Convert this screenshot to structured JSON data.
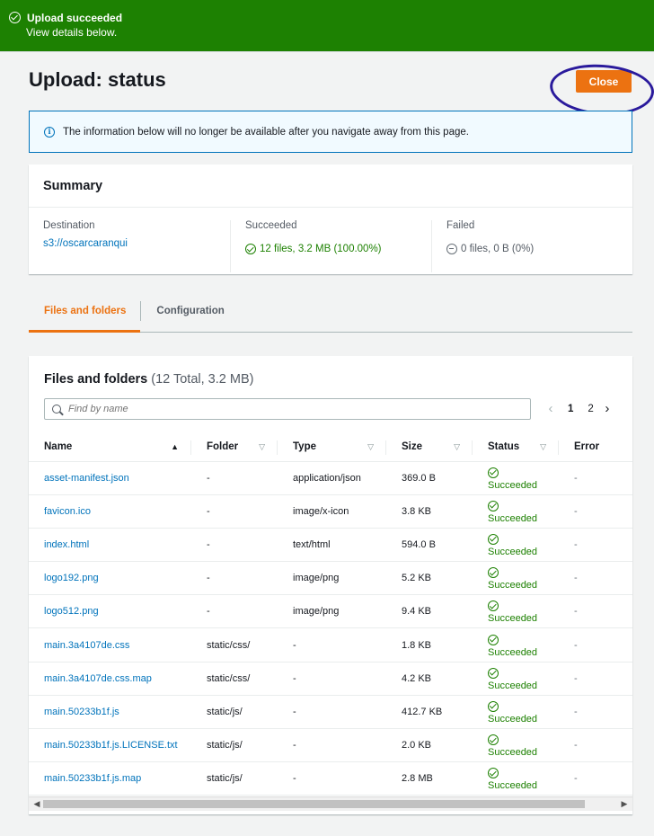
{
  "flash": {
    "title": "Upload succeeded",
    "subtitle": "View details below."
  },
  "page": {
    "title": "Upload: status",
    "close_label": "Close"
  },
  "info": {
    "text": "The information below will no longer be available after you navigate away from this page."
  },
  "summary": {
    "heading": "Summary",
    "destination_label": "Destination",
    "destination_value": "s3://oscarcaranqui",
    "succeeded_label": "Succeeded",
    "succeeded_value": "12 files, 3.2 MB (100.00%)",
    "failed_label": "Failed",
    "failed_value": "0 files, 0 B (0%)"
  },
  "tabs": [
    {
      "label": "Files and folders",
      "active": true
    },
    {
      "label": "Configuration",
      "active": false
    }
  ],
  "files": {
    "title": "Files and folders",
    "count": "(12 Total, 3.2 MB)",
    "search_placeholder": "Find by name",
    "pager": {
      "pages": [
        "1",
        "2"
      ],
      "current": "1"
    },
    "columns": [
      "Name",
      "Folder",
      "Type",
      "Size",
      "Status",
      "Error"
    ],
    "rows": [
      {
        "name": "asset-manifest.json",
        "folder": "-",
        "type": "application/json",
        "size": "369.0 B",
        "status": "Succeeded",
        "error": "-"
      },
      {
        "name": "favicon.ico",
        "folder": "-",
        "type": "image/x-icon",
        "size": "3.8 KB",
        "status": "Succeeded",
        "error": "-"
      },
      {
        "name": "index.html",
        "folder": "-",
        "type": "text/html",
        "size": "594.0 B",
        "status": "Succeeded",
        "error": "-"
      },
      {
        "name": "logo192.png",
        "folder": "-",
        "type": "image/png",
        "size": "5.2 KB",
        "status": "Succeeded",
        "error": "-"
      },
      {
        "name": "logo512.png",
        "folder": "-",
        "type": "image/png",
        "size": "9.4 KB",
        "status": "Succeeded",
        "error": "-"
      },
      {
        "name": "main.3a4107de.css",
        "folder": "static/css/",
        "type": "-",
        "size": "1.8 KB",
        "status": "Succeeded",
        "error": "-"
      },
      {
        "name": "main.3a4107de.css.map",
        "folder": "static/css/",
        "type": "-",
        "size": "4.2 KB",
        "status": "Succeeded",
        "error": "-"
      },
      {
        "name": "main.50233b1f.js",
        "folder": "static/js/",
        "type": "-",
        "size": "412.7 KB",
        "status": "Succeeded",
        "error": "-"
      },
      {
        "name": "main.50233b1f.js.LICENSE.txt",
        "folder": "static/js/",
        "type": "-",
        "size": "2.0 KB",
        "status": "Succeeded",
        "error": "-"
      },
      {
        "name": "main.50233b1f.js.map",
        "folder": "static/js/",
        "type": "-",
        "size": "2.8 MB",
        "status": "Succeeded",
        "error": "-"
      }
    ]
  },
  "colors": {
    "success": "#1d8102",
    "primary_button": "#ec7211",
    "link": "#0073bb",
    "annotation": "#2a1a9c"
  }
}
